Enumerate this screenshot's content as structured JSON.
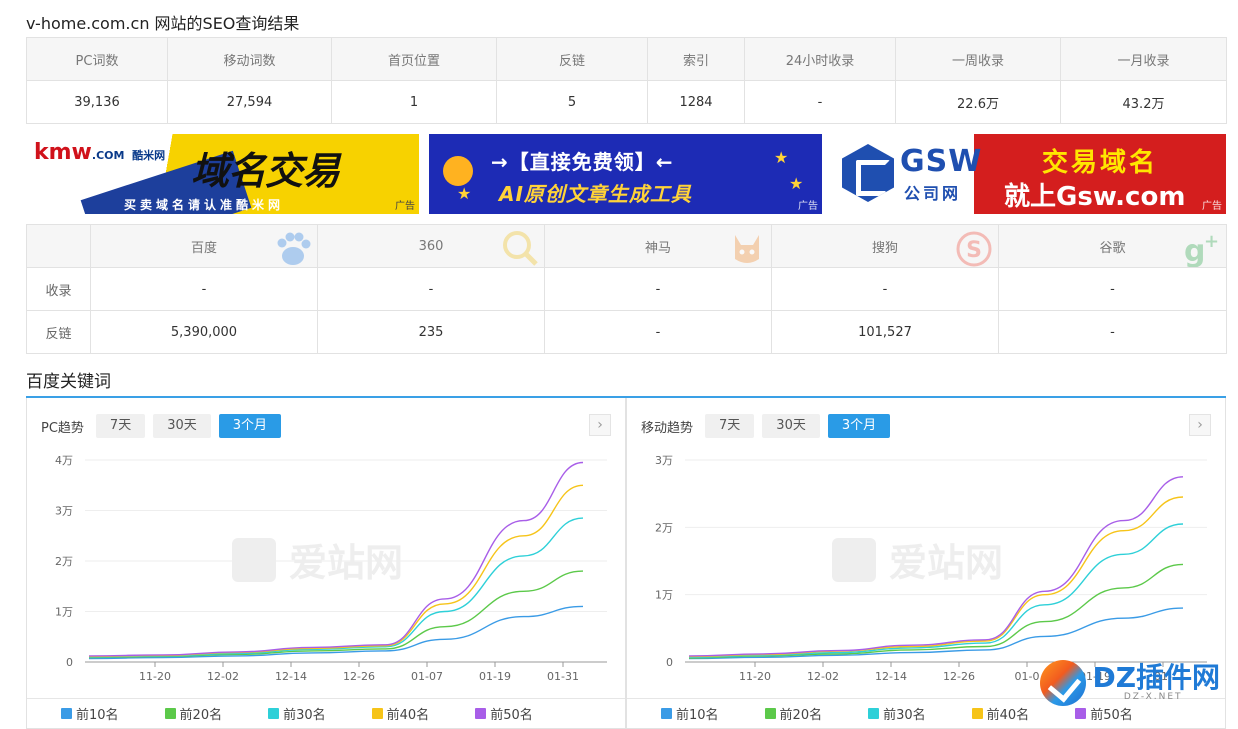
{
  "page_title": "v-home.com.cn 网站的SEO查询结果",
  "seo_table": {
    "headers": [
      "PC词数",
      "移动词数",
      "首页位置",
      "反链",
      "索引",
      "24小时收录",
      "一周收录",
      "一月收录"
    ],
    "values": [
      "39,136",
      "27,594",
      "1",
      "5",
      "1284",
      "-",
      "22.6万",
      "43.2万"
    ]
  },
  "ads": [
    {
      "brand": "kmw",
      "brand_cn": "酷米网",
      "brand_suffix": ".COM",
      "headline": "域名交易",
      "subline": "买卖域名请认准酷米网",
      "tag": "广告"
    },
    {
      "headline": "→【直接免费领】←",
      "subline": "AI原创文章生成工具",
      "tag": "广告"
    },
    {
      "brand": "GSW",
      "brand_sub": "公司网",
      "headline": "交易域名",
      "subline": "就上Gsw.com",
      "tag": "广告"
    }
  ],
  "engines": {
    "headers": [
      "百度",
      "360",
      "神马",
      "搜狗",
      "谷歌"
    ],
    "icons": [
      "paw-icon",
      "search-magnifier-icon",
      "shenma-icon",
      "sogou-s-icon",
      "google-plus-icon"
    ],
    "rows": [
      {
        "label": "收录",
        "values": [
          "-",
          "-",
          "-",
          "-",
          "-"
        ]
      },
      {
        "label": "反链",
        "values": [
          "5,390,000",
          "235",
          "-",
          "101,527",
          "-"
        ]
      }
    ]
  },
  "section_title": "百度关键词",
  "pc_panel": {
    "title": "PC趋势",
    "ranges": [
      "7天",
      "30天",
      "3个月"
    ],
    "active_range": "3个月",
    "next_icon": "chevron-right-icon",
    "watermark": "爱站网"
  },
  "mobile_panel": {
    "title": "移动趋势",
    "ranges": [
      "7天",
      "30天",
      "3个月"
    ],
    "active_range": "3个月",
    "next_icon": "chevron-right-icon",
    "watermark": "爱站网"
  },
  "legend": [
    {
      "name": "前10名",
      "color": "#3a9be6"
    },
    {
      "name": "前20名",
      "color": "#5cc94a"
    },
    {
      "name": "前30名",
      "color": "#2ed0d8"
    },
    {
      "name": "前40名",
      "color": "#f6c419"
    },
    {
      "name": "前50名",
      "color": "#a85ee8"
    }
  ],
  "dz_badge": {
    "text": "DZ插件网",
    "sub": "DZ-X.NET"
  },
  "chart_data": [
    {
      "type": "line",
      "title": "PC趋势",
      "x": [
        "11-20",
        "12-02",
        "12-14",
        "12-26",
        "01-07",
        "01-19",
        "01-31"
      ],
      "x_ticks": [
        "11-20",
        "12-02",
        "12-14",
        "12-26",
        "01-07",
        "01-19",
        "01-31"
      ],
      "y_ticks": [
        "0",
        "1万",
        "2万",
        "3万",
        "4万"
      ],
      "ylim": [
        0,
        40000
      ],
      "series": [
        {
          "name": "前10名",
          "color": "#3a9be6",
          "values": [
            700,
            900,
            1200,
            1800,
            2200,
            4500,
            9000,
            11000
          ]
        },
        {
          "name": "前20名",
          "color": "#5cc94a",
          "values": [
            900,
            1100,
            1500,
            2200,
            2600,
            7000,
            14000,
            18000
          ]
        },
        {
          "name": "前30名",
          "color": "#2ed0d8",
          "values": [
            1000,
            1200,
            1700,
            2500,
            3000,
            10000,
            21000,
            28500
          ]
        },
        {
          "name": "前40名",
          "color": "#f6c419",
          "values": [
            1100,
            1300,
            1900,
            2700,
            3200,
            11500,
            25000,
            35000
          ]
        },
        {
          "name": "前50名",
          "color": "#a85ee8",
          "values": [
            1200,
            1400,
            2000,
            2900,
            3400,
            12500,
            28000,
            39500
          ]
        }
      ],
      "grid": true,
      "legend": "bottom"
    },
    {
      "type": "line",
      "title": "移动趋势",
      "x": [
        "11-20",
        "12-02",
        "12-14",
        "12-26",
        "01-07",
        "01-19",
        "01-31"
      ],
      "x_ticks": [
        "11-20",
        "12-02",
        "12-14",
        "12-26",
        "01-0",
        "01-19",
        "01-"
      ],
      "y_ticks": [
        "0",
        "1万",
        "2万",
        "3万"
      ],
      "ylim": [
        0,
        30000
      ],
      "series": [
        {
          "name": "前10名",
          "color": "#3a9be6",
          "values": [
            500,
            700,
            1000,
            1400,
            1800,
            3800,
            6500,
            8000
          ]
        },
        {
          "name": "前20名",
          "color": "#5cc94a",
          "values": [
            600,
            900,
            1200,
            1800,
            2300,
            6000,
            11000,
            14500
          ]
        },
        {
          "name": "前30名",
          "color": "#2ed0d8",
          "values": [
            700,
            1000,
            1400,
            2100,
            2800,
            8500,
            16000,
            20500
          ]
        },
        {
          "name": "前40名",
          "color": "#f6c419",
          "values": [
            800,
            1100,
            1600,
            2300,
            3100,
            10000,
            19500,
            24500
          ]
        },
        {
          "name": "前50名",
          "color": "#a85ee8",
          "values": [
            900,
            1200,
            1700,
            2500,
            3300,
            10500,
            21000,
            27500
          ]
        }
      ],
      "grid": true,
      "legend": "bottom"
    }
  ]
}
